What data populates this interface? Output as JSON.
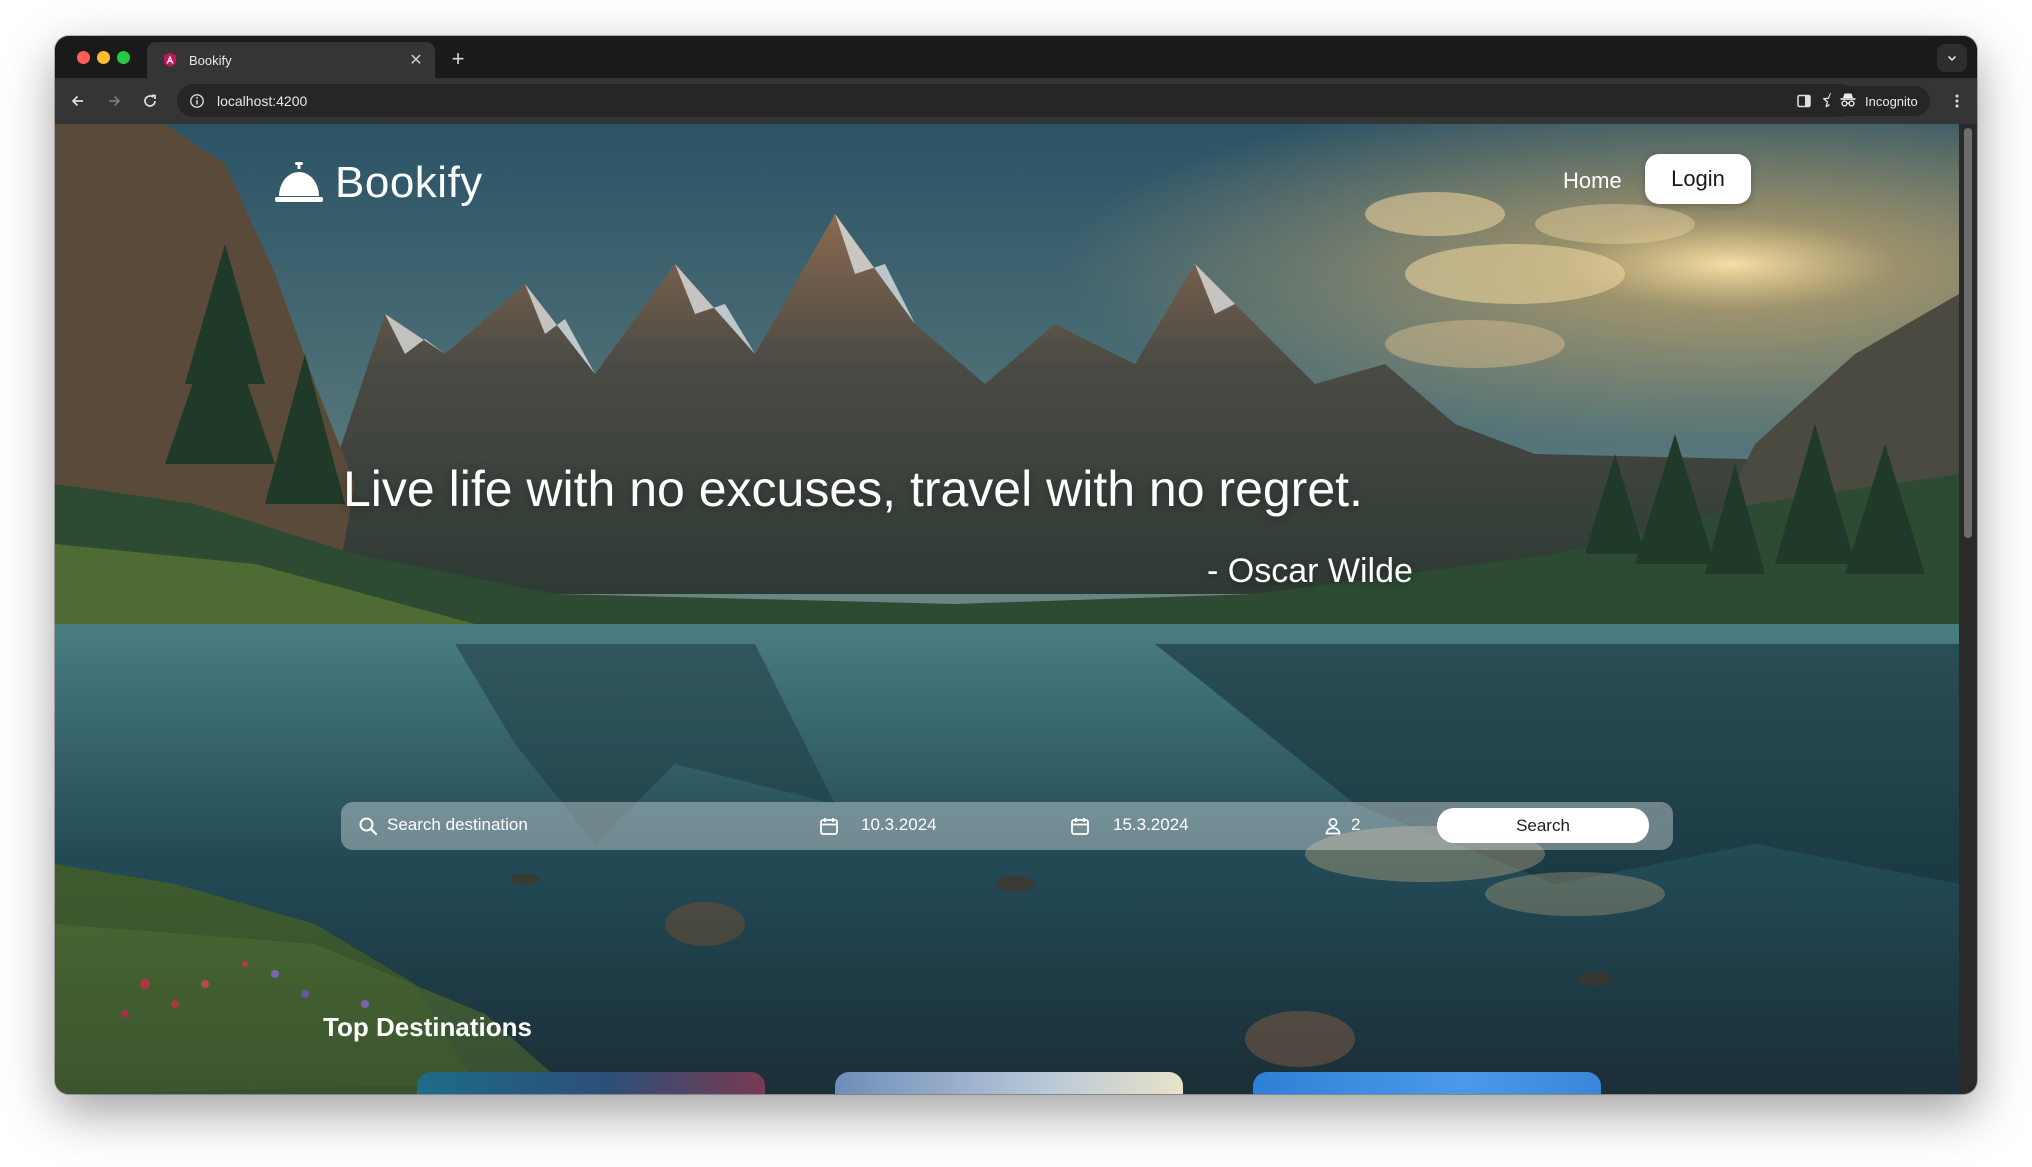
{
  "browser": {
    "tab_title": "Bookify",
    "tab_close": "✕",
    "new_tab": "+",
    "url": "localhost:4200",
    "incognito_label": "Incognito"
  },
  "site": {
    "brand": "Bookify",
    "nav": {
      "home": "Home",
      "login": "Login"
    }
  },
  "hero": {
    "quote": "Live life with no excuses, travel with no regret.",
    "author": "- Oscar Wilde"
  },
  "search": {
    "destination_placeholder": "Search destination",
    "checkin_date": "10.3.2024",
    "checkout_date": "15.3.2024",
    "guests": "2",
    "button_label": "Search"
  },
  "sections": {
    "top_destinations_title": "Top Destinations"
  },
  "colors": {
    "traffic_red": "#ff5f57",
    "traffic_yellow": "#febc2e",
    "traffic_green": "#28c840",
    "favicon": "#c2185b"
  },
  "icons": {
    "logo": "service-bell-icon",
    "search": "magnifier-icon",
    "date": "calendar-icon",
    "guests": "person-icon"
  }
}
